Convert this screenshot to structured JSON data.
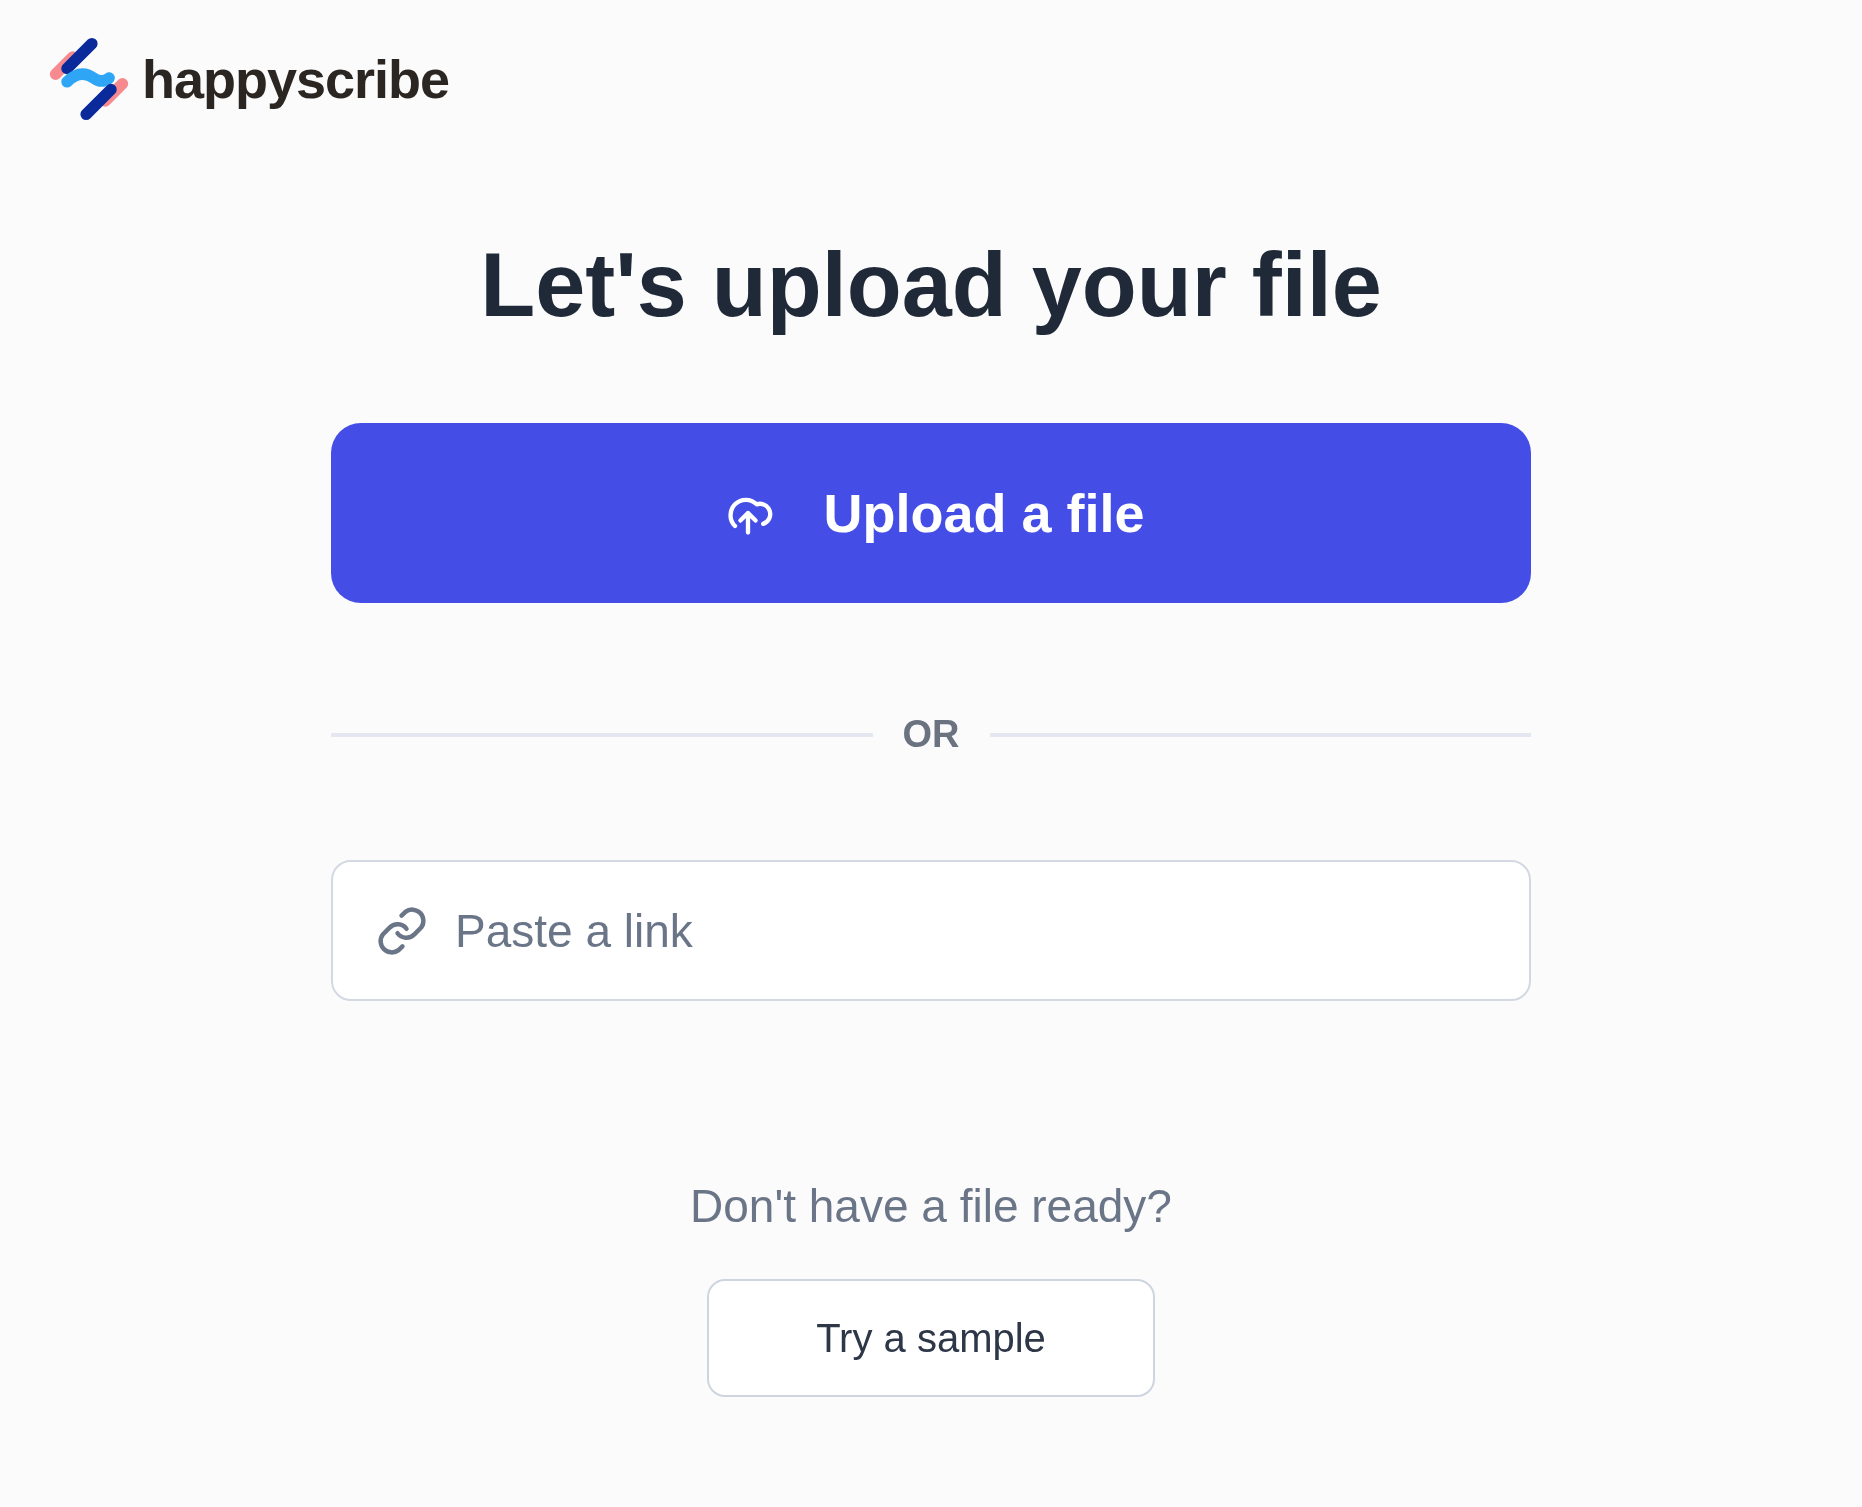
{
  "logo": {
    "text": "happyscribe"
  },
  "title": "Let's upload your file",
  "upload_button": {
    "label": "Upload a file"
  },
  "divider": {
    "label": "OR"
  },
  "link_field": {
    "placeholder": "Paste a link"
  },
  "sample": {
    "prompt": "Don't have a file ready?",
    "button": "Try a sample"
  }
}
